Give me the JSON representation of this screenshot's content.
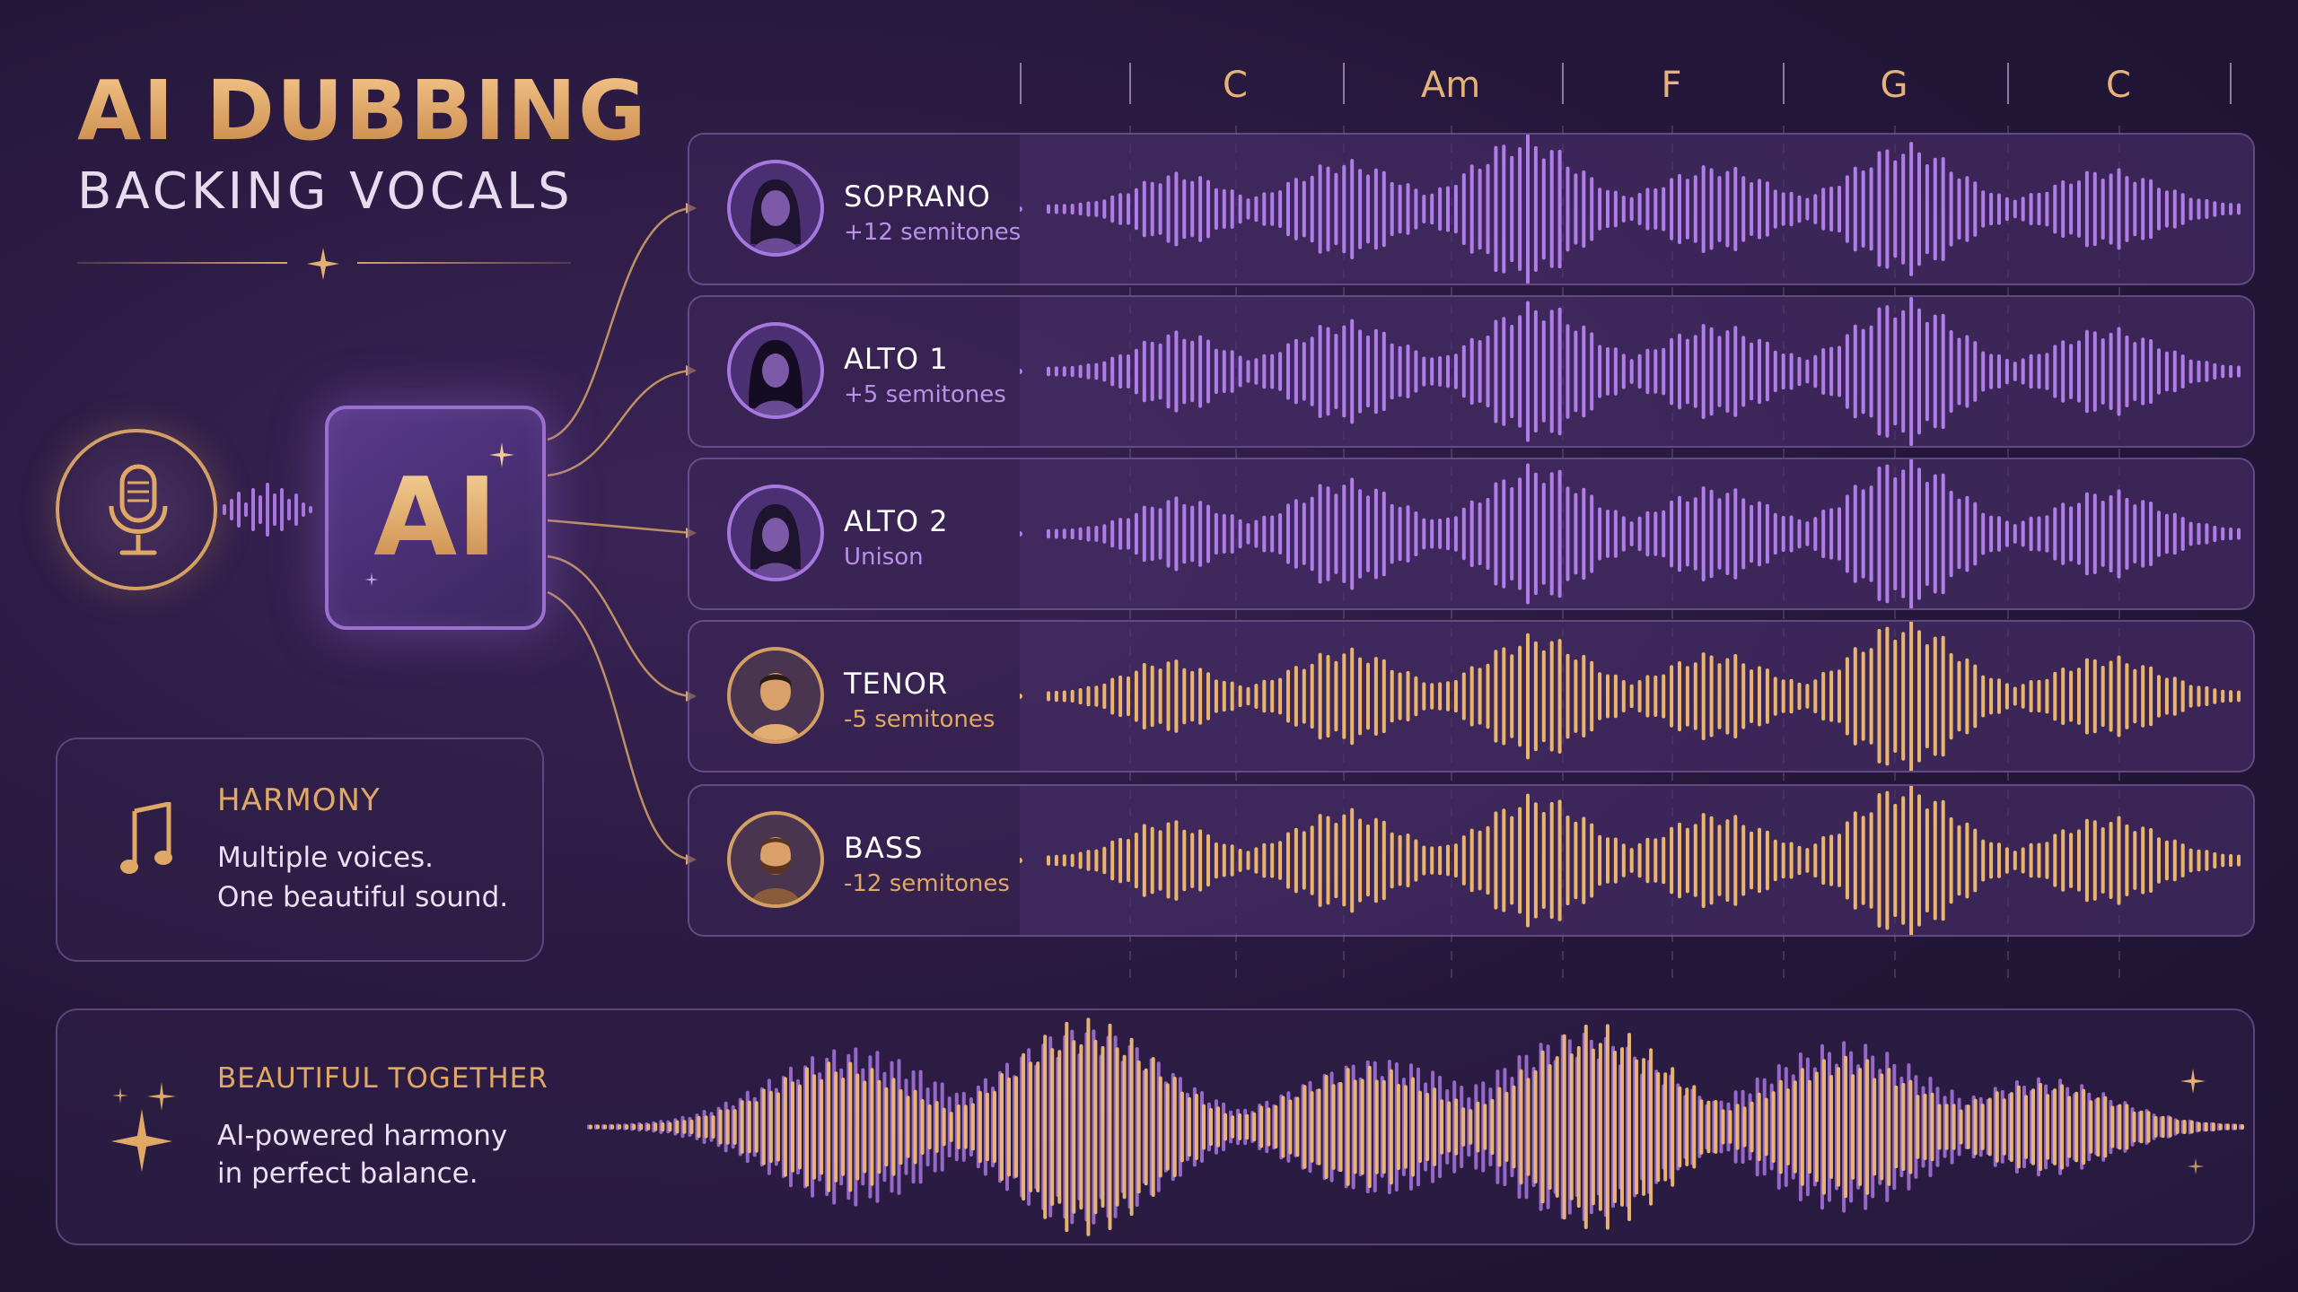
{
  "header": {
    "title": "AI DUBBING",
    "subtitle": "BACKING VOCALS"
  },
  "chords": [
    "C",
    "Am",
    "F",
    "G",
    "C"
  ],
  "ai_box": {
    "label": "AI"
  },
  "tracks": [
    {
      "name": "SOPRANO",
      "detail": "+12 semitones",
      "color": "#b07ce8",
      "avatar": "female-avatar-icon"
    },
    {
      "name": "ALTO 1",
      "detail": "+5 semitones",
      "color": "#b07ce8",
      "avatar": "female-avatar-icon"
    },
    {
      "name": "ALTO 2",
      "detail": "Unison",
      "color": "#b07ce8",
      "avatar": "female-avatar-icon"
    },
    {
      "name": "TENOR",
      "detail": "-5 semitones",
      "color": "#e9b56c",
      "avatar": "male-avatar-icon"
    },
    {
      "name": "BASS",
      "detail": "-12 semitones",
      "color": "#e9b56c",
      "avatar": "bearded-male-avatar-icon"
    }
  ],
  "harmony": {
    "title": "HARMONY",
    "line1": "Multiple voices.",
    "line2": "One beautiful sound."
  },
  "together": {
    "title": "BEAUTIFUL TOGETHER",
    "line1": "AI-powered harmony",
    "line2": "in perfect balance."
  },
  "colors": {
    "gold": "#e0a865",
    "purple": "#b07ce8",
    "background": "#25173a"
  }
}
